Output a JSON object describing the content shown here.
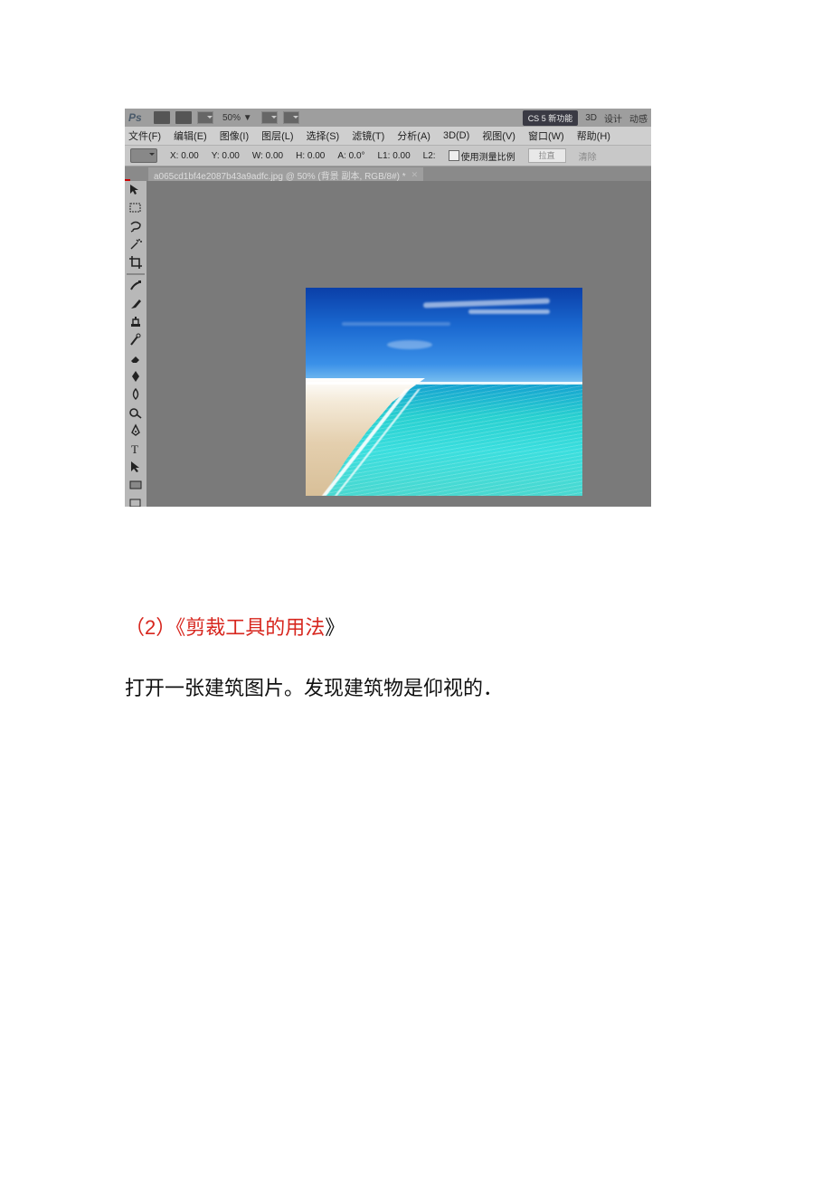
{
  "ps": {
    "logo": "Ps",
    "zoom": "50% ▼",
    "top_tabs": {
      "cs5": "CS 5 新功能",
      "t3d": "3D",
      "design": "设计",
      "motion": "动感"
    },
    "menu": {
      "file": "文件(F)",
      "edit": "编辑(E)",
      "image": "图像(I)",
      "layer": "图层(L)",
      "select": "选择(S)",
      "filter": "滤镜(T)",
      "analysis": "分析(A)",
      "d3d": "3D(D)",
      "view": "视图(V)",
      "window": "窗口(W)",
      "help": "帮助(H)"
    },
    "options": {
      "x": "X: 0.00",
      "y": "Y: 0.00",
      "w": "W: 0.00",
      "h": "H: 0.00",
      "a": "A: 0.0°",
      "l1": "L1: 0.00",
      "l2": "L2:",
      "use_scale": "使用测量比例",
      "straighten": "拉直",
      "clear": "清除"
    },
    "doc_tab": "a065cd1bf4e2087b43a9adfc.jpg @ 50% (背景 副本, RGB/8#) *"
  },
  "article": {
    "prefix": "（2）《",
    "title": "剪裁工具的用法",
    "suffix": "》",
    "body": "打开一张建筑图片。发现建筑物是仰视的．"
  }
}
